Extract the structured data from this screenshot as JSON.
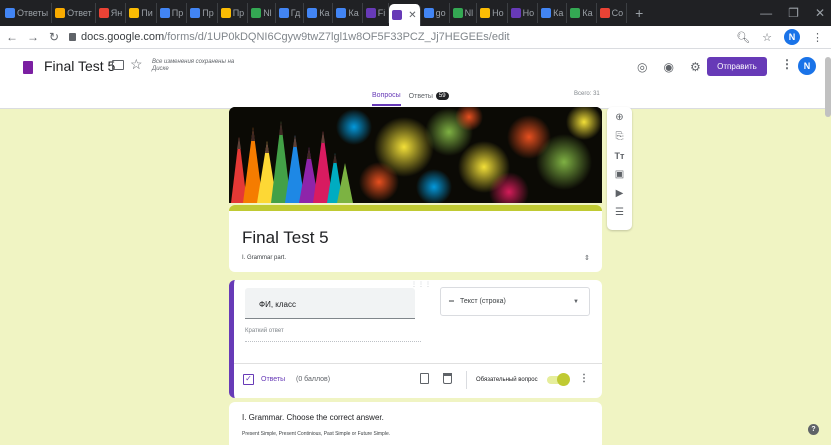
{
  "browser": {
    "tabs": [
      {
        "label": "Ответы",
        "icon": "doc-icon",
        "color": "#4285f4"
      },
      {
        "label": "Ответ",
        "icon": "doc-icon",
        "color": "#f9ab00"
      },
      {
        "label": "Ян",
        "icon": "yandex-icon",
        "color": "#ea4335"
      },
      {
        "label": "Пи",
        "icon": "mail-icon",
        "color": "#fbbc04"
      },
      {
        "label": "Пр",
        "icon": "doc-icon",
        "color": "#4285f4"
      },
      {
        "label": "Пр",
        "icon": "slides-icon",
        "color": "#4285f4"
      },
      {
        "label": "Пр",
        "icon": "slides-icon",
        "color": "#fbbc04"
      },
      {
        "label": "Nl",
        "icon": "drive-icon",
        "color": "#34a853"
      },
      {
        "label": "Гд",
        "icon": "google-icon",
        "color": "#4285f4"
      },
      {
        "label": "Ка",
        "icon": "google-icon",
        "color": "#4285f4"
      },
      {
        "label": "Ка",
        "icon": "google-icon",
        "color": "#4285f4"
      },
      {
        "label": "Fi",
        "icon": "forms-icon",
        "color": "#673ab7"
      },
      {
        "label": "",
        "icon": "forms-icon",
        "color": "#673ab7",
        "active": true
      },
      {
        "label": "go",
        "icon": "google-icon",
        "color": "#4285f4"
      },
      {
        "label": "Nl",
        "icon": "drive-icon",
        "color": "#34a853"
      },
      {
        "label": "Но",
        "icon": "drive-icon",
        "color": "#fbbc04"
      },
      {
        "label": "Но",
        "icon": "forms-icon",
        "color": "#673ab7"
      },
      {
        "label": "Ка",
        "icon": "google-icon",
        "color": "#4285f4"
      },
      {
        "label": "Ка",
        "icon": "meet-icon",
        "color": "#34a853"
      },
      {
        "label": "Co",
        "icon": "video-icon",
        "color": "#ea4335"
      }
    ],
    "new_tab": "+",
    "window": {
      "minimize": "—",
      "restore": "❐",
      "close": "✕"
    },
    "url_host": "docs.google.com",
    "url_path": "/forms/d/1UP0kDQNI6Cgyw9twZ7lgl1w8OF5F33PCZ_Jj7HEGEEs/edit",
    "avatar": "N"
  },
  "form_header": {
    "title": "Final Test 5",
    "saved_text": "Все изменения сохранены на Диске",
    "send_label": "Отправить",
    "avatar": "N",
    "tabs": {
      "questions": "Вопросы",
      "answers": "Ответы",
      "answers_count": "59"
    },
    "total": "Всего: 31"
  },
  "title_card": {
    "title": "Final Test 5",
    "description": "I. Grammar part."
  },
  "question": {
    "drag_handle": "⋮⋮⋮",
    "text": "ФИ, класс",
    "type": "Текст (строка)",
    "short_answer_placeholder": "Краткий ответ",
    "answers_link": "Ответы",
    "points": "(0 баллов)",
    "required_label": "Обязательный вопрос",
    "required": true
  },
  "question2": {
    "title": "I. Grammar. Choose the correct answer.",
    "description": "Present Simple, Present Continious, Past Simple or Future Simple."
  },
  "colors": {
    "page_bg": "#f0f4c3",
    "accent": "#673ab7",
    "theme": "#c0ca33"
  }
}
